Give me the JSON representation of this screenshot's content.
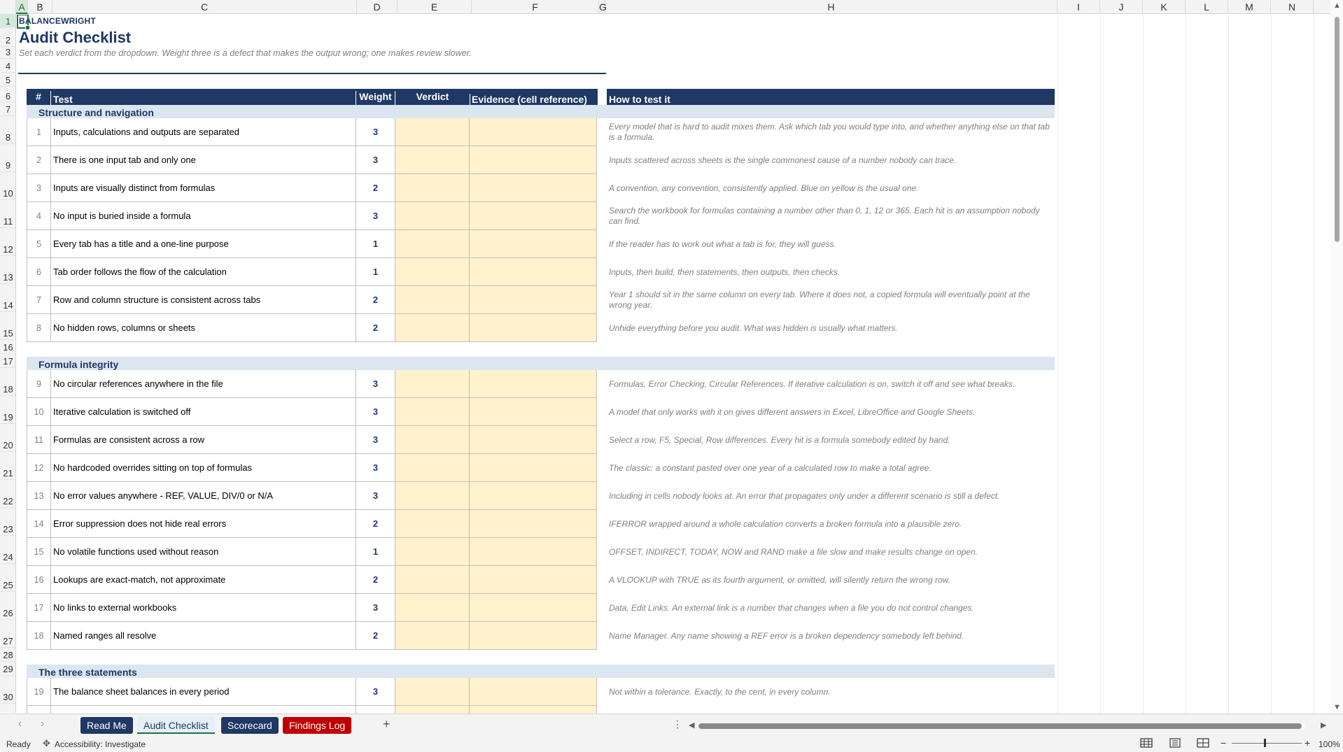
{
  "columns": [
    "A",
    "B",
    "C",
    "D",
    "E",
    "F",
    "G",
    "H",
    "I",
    "J",
    "K",
    "L",
    "M",
    "N"
  ],
  "rows": [
    "1",
    "2",
    "3",
    "4",
    "5",
    "6",
    "7",
    "8",
    "9",
    "10",
    "11",
    "12",
    "13",
    "14",
    "15",
    "16",
    "17",
    "18",
    "19",
    "20",
    "21",
    "22",
    "23",
    "24",
    "25",
    "26",
    "27",
    "28",
    "29",
    "30"
  ],
  "brand": "BALANCEWRIGHT",
  "title": "Audit Checklist",
  "subtitle": "Set each verdict from the dropdown. Weight three is a defect that makes the output wrong; one makes review slower.",
  "headers": {
    "num": "#",
    "test": "Test",
    "weight": "Weight",
    "verdict": "Verdict",
    "evidence": "Evidence (cell reference)",
    "how": "How to test it"
  },
  "sections": [
    {
      "name": "Structure and navigation",
      "items": [
        {
          "n": "1",
          "test": "Inputs, calculations and outputs are separated",
          "weight": "3",
          "how": "Every model that is hard to audit mixes them. Ask which tab you would type into, and whether anything else on that tab is a formula."
        },
        {
          "n": "2",
          "test": "There is one input tab and only one",
          "weight": "3",
          "how": "Inputs scattered across sheets is the single commonest cause of a number nobody can trace."
        },
        {
          "n": "3",
          "test": "Inputs are visually distinct from formulas",
          "weight": "2",
          "how": "A convention, any convention, consistently applied. Blue on yellow is the usual one."
        },
        {
          "n": "4",
          "test": "No input is buried inside a formula",
          "weight": "3",
          "how": "Search the workbook for formulas containing a number other than 0, 1, 12 or 365. Each hit is an assumption nobody can find."
        },
        {
          "n": "5",
          "test": "Every tab has a title and a one-line purpose",
          "weight": "1",
          "how": "If the reader has to work out what a tab is for, they will guess."
        },
        {
          "n": "6",
          "test": "Tab order follows the flow of the calculation",
          "weight": "1",
          "how": "Inputs, then build, then statements, then outputs, then checks."
        },
        {
          "n": "7",
          "test": "Row and column structure is consistent across tabs",
          "weight": "2",
          "how": "Year 1 should sit in the same column on every tab. Where it does not, a copied formula will eventually point at the wrong year."
        },
        {
          "n": "8",
          "test": "No hidden rows, columns or sheets",
          "weight": "2",
          "how": "Unhide everything before you audit. What was hidden is usually what matters."
        }
      ]
    },
    {
      "name": "Formula integrity",
      "items": [
        {
          "n": "9",
          "test": "No circular references anywhere in the file",
          "weight": "3",
          "how": "Formulas, Error Checking, Circular References. If iterative calculation is on, switch it off and see what breaks."
        },
        {
          "n": "10",
          "test": "Iterative calculation is switched off",
          "weight": "3",
          "how": "A model that only works with it on gives different answers in Excel, LibreOffice and Google Sheets."
        },
        {
          "n": "11",
          "test": "Formulas are consistent across a row",
          "weight": "3",
          "how": "Select a row, F5, Special, Row differences. Every hit is a formula somebody edited by hand."
        },
        {
          "n": "12",
          "test": "No hardcoded overrides sitting on top of formulas",
          "weight": "3",
          "how": "The classic: a constant pasted over one year of a calculated row to make a total agree."
        },
        {
          "n": "13",
          "test": "No error values anywhere - REF, VALUE, DIV/0 or N/A",
          "weight": "3",
          "how": "Including in cells nobody looks at. An error that propagates only under a different scenario is still a defect."
        },
        {
          "n": "14",
          "test": "Error suppression does not hide real errors",
          "weight": "2",
          "how": "IFERROR wrapped around a whole calculation converts a broken formula into a plausible zero."
        },
        {
          "n": "15",
          "test": "No volatile functions used without reason",
          "weight": "1",
          "how": "OFFSET, INDIRECT, TODAY, NOW and RAND make a file slow and make results change on open."
        },
        {
          "n": "16",
          "test": "Lookups are exact-match, not approximate",
          "weight": "2",
          "how": "A VLOOKUP with TRUE as its fourth argument, or omitted, will silently return the wrong row."
        },
        {
          "n": "17",
          "test": "No links to external workbooks",
          "weight": "3",
          "how": "Data, Edit Links. An external link is a number that changes when a file you do not control changes."
        },
        {
          "n": "18",
          "test": "Named ranges all resolve",
          "weight": "2",
          "how": "Name Manager. Any name showing a REF error is a broken dependency somebody left behind."
        }
      ]
    },
    {
      "name": "The three statements",
      "items": [
        {
          "n": "19",
          "test": "The balance sheet balances in every period",
          "weight": "3",
          "how": "Not within a tolerance. Exactly, to the cent, in every column."
        }
      ]
    }
  ],
  "sheet_tabs": [
    "Read Me",
    "Audit Checklist",
    "Scorecard",
    "Findings Log"
  ],
  "add_sheet": "+",
  "status": {
    "ready": "Ready",
    "accessibility": "Accessibility: Investigate",
    "zoom": "100%"
  },
  "colors": {
    "navy": "#1f3864",
    "section_fill": "#dce6f1",
    "input_fill": "#fff2cc",
    "red_tab": "#c00000",
    "excel_green": "#1e7145"
  }
}
